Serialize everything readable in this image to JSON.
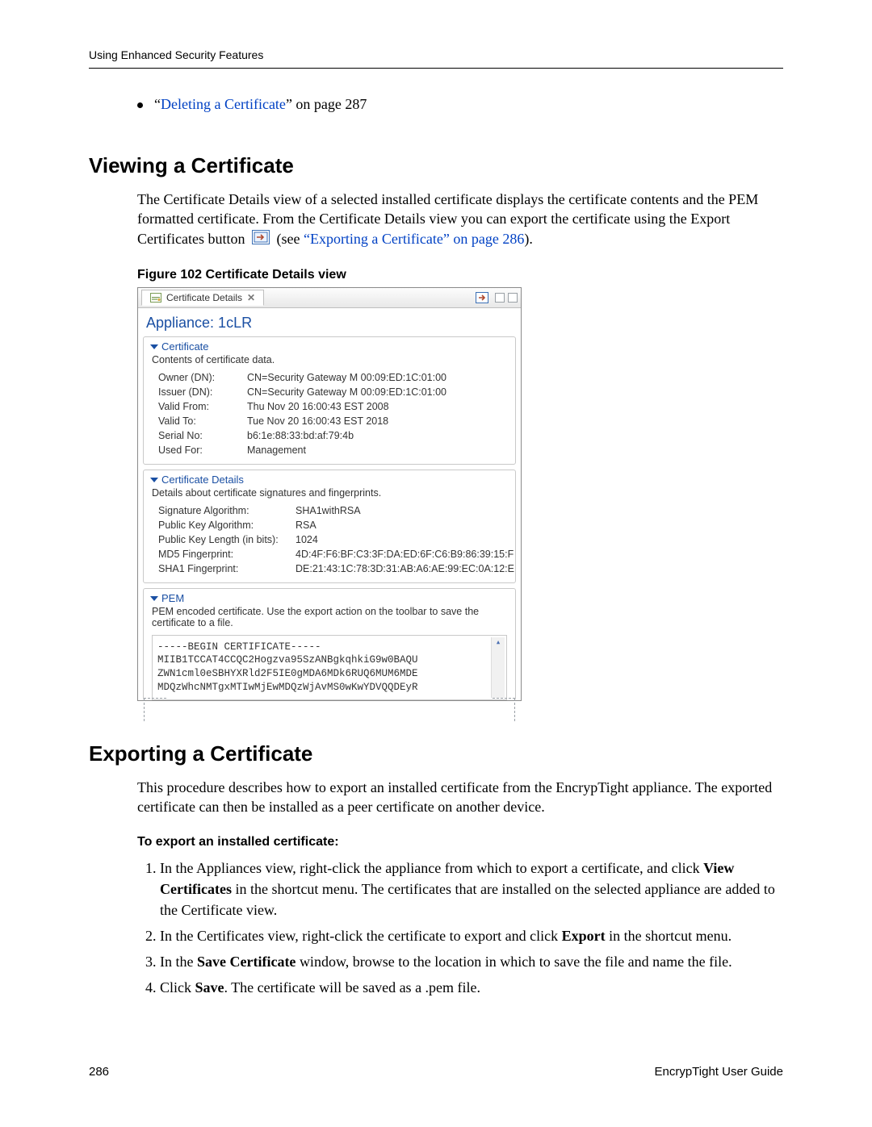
{
  "header": {
    "running_head": "Using Enhanced Security Features"
  },
  "bullets": [
    {
      "prefix": "“",
      "link": "Deleting a Certificate",
      "suffix": "” on page 287"
    }
  ],
  "section1": {
    "title": "Viewing a Certificate",
    "para_before": "The Certificate Details view of a selected installed certificate displays the certificate contents and the PEM formatted certificate. From the Certificate Details view you can export the certificate using the Export Certificates button",
    "para_after_open": " (see ",
    "link": "“Exporting a Certificate” on page 286",
    "para_after_close": ").",
    "fig_caption": "Figure 102  Certificate Details view"
  },
  "fig": {
    "tab_label": "Certificate Details",
    "appliance_label": "Appliance: 1cLR",
    "cert": {
      "title": "Certificate",
      "desc": "Contents of certificate data.",
      "rows": [
        [
          "Owner (DN):",
          "CN=Security Gateway M 00:09:ED:1C:01:00"
        ],
        [
          "Issuer (DN):",
          "CN=Security Gateway M 00:09:ED:1C:01:00"
        ],
        [
          "Valid From:",
          "Thu Nov 20 16:00:43 EST 2008"
        ],
        [
          "Valid To:",
          "Tue Nov 20 16:00:43 EST 2018"
        ],
        [
          "Serial No:",
          "b6:1e:88:33:bd:af:79:4b"
        ],
        [
          "Used For:",
          "Management"
        ]
      ]
    },
    "details": {
      "title": "Certificate Details",
      "desc": "Details about certificate signatures and fingerprints.",
      "rows": [
        [
          "Signature Algorithm:",
          "SHA1withRSA"
        ],
        [
          "Public Key Algorithm:",
          "RSA"
        ],
        [
          "Public Key Length (in bits):",
          "1024"
        ],
        [
          "MD5 Fingerprint:",
          "4D:4F:F6:BF:C3:3F:DA:ED:6F:C6:B9:86:39:15:F"
        ],
        [
          "SHA1 Fingerprint:",
          "DE:21:43:1C:78:3D:31:AB:A6:AE:99:EC:0A:12:E"
        ]
      ]
    },
    "pem": {
      "title": "PEM",
      "desc": "PEM encoded certificate.  Use the export action on the toolbar to save the certificate to a file.",
      "lines": [
        "-----BEGIN CERTIFICATE-----",
        "MIIB1TCCAT4CCQC2Hogzva95SzANBgkqhkiG9w0BAQU",
        "ZWN1cml0eSBHYXRld2F5IE0gMDA6MDk6RUQ6MUM6MDE",
        "MDQzWhcNMTgxMTIwMjEwMDQzWjAvMS0wKwYDVQQDEyR"
      ]
    }
  },
  "section2": {
    "title": "Exporting a Certificate",
    "para": "This procedure describes how to export an installed certificate from the EncrypTight appliance. The exported certificate can then be installed as a peer certificate on another device.",
    "sub": "To export an installed certificate:",
    "steps": [
      {
        "pre": "In the Appliances view, right-click the appliance from which to export a certificate, and click ",
        "bold": "View Certificates",
        "post": " in the shortcut menu. The certificates that are installed on the selected appliance are added to the Certificate view."
      },
      {
        "pre": "In the Certificates view, right-click the certificate to export and click ",
        "bold": "Export",
        "post": " in the shortcut menu."
      },
      {
        "pre": "In the ",
        "bold": "Save Certificate",
        "post": " window, browse to the location in which to save the file and name the file."
      },
      {
        "pre": "Click ",
        "bold": "Save",
        "post": ". The certificate will be saved as a .pem file."
      }
    ]
  },
  "footer": {
    "page_no": "286",
    "doc": "EncrypTight User Guide"
  }
}
